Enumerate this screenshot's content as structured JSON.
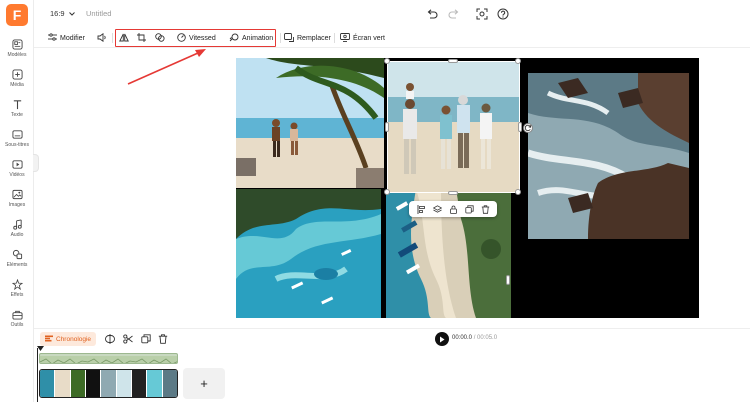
{
  "app": {
    "logo_letter": "F",
    "brand_color": "#ff7a2f",
    "highlight_color": "#e53935",
    "accent_selection": "#ffffff"
  },
  "sidebar": {
    "items": [
      {
        "label": "Modèles",
        "icon": "templates-icon"
      },
      {
        "label": "Média",
        "icon": "media-icon"
      },
      {
        "label": "Texte",
        "icon": "text-icon"
      },
      {
        "label": "Sous-titres",
        "icon": "subtitles-icon"
      },
      {
        "label": "Vidéos",
        "icon": "video-icon"
      },
      {
        "label": "Images",
        "icon": "image-icon"
      },
      {
        "label": "Audio",
        "icon": "audio-icon"
      },
      {
        "label": "Eléments",
        "icon": "elements-icon"
      },
      {
        "label": "Effets",
        "icon": "effects-icon"
      },
      {
        "label": "Outils",
        "icon": "tools-icon"
      }
    ]
  },
  "topbar": {
    "aspect_ratio": "16:9",
    "title": "Untitled",
    "icons": [
      "undo-icon",
      "redo-icon",
      "screenshot-icon",
      "help-icon"
    ]
  },
  "toolbar": {
    "modifier_label": "Modifier",
    "vitesse_label": "Vitessed",
    "animation_label": "Animation",
    "replace_label": "Remplacer",
    "green_screen_label": "Écran vert"
  },
  "floating_toolbar": {
    "icons": [
      "align-icon",
      "layers-icon",
      "lock-icon",
      "duplicate-icon",
      "delete-icon"
    ]
  },
  "timeline": {
    "chrono_label": "Chronologie",
    "current_time": "00:00.0",
    "separator": "/",
    "duration": "00:05.0",
    "add_label": "+"
  }
}
